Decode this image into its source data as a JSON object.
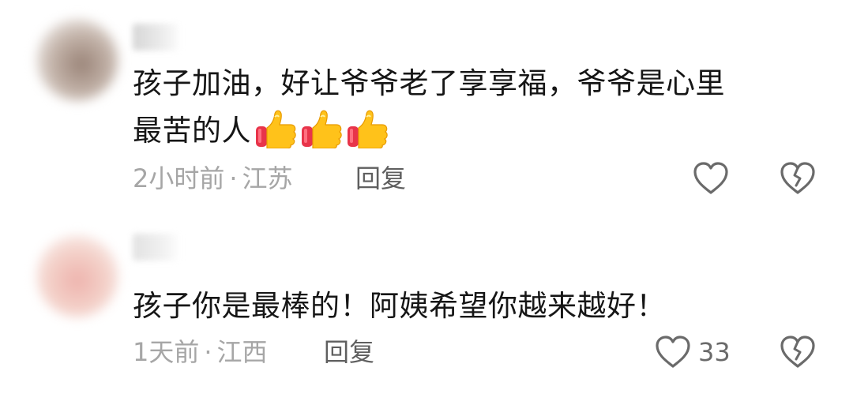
{
  "comments": [
    {
      "text_line1": "孩子加油，好让爷爷老了享享福，爷爷是心里",
      "text_line2": "最苦的人",
      "emoji": [
        "thumbs-up-icon",
        "thumbs-up-icon",
        "thumbs-up-icon"
      ],
      "time": "2小时前",
      "separator": "·",
      "location": "江苏",
      "reply_label": "回复",
      "like_count": ""
    },
    {
      "text_line1": "孩子你是最棒的！阿姨希望你越来越好！",
      "time": "1天前",
      "separator": "·",
      "location": "江西",
      "reply_label": "回复",
      "like_count": "33"
    }
  ],
  "colors": {
    "text": "#161616",
    "meta": "#a6a6a6",
    "reply": "#5f5f5f",
    "icon": "#6a6a6a"
  }
}
